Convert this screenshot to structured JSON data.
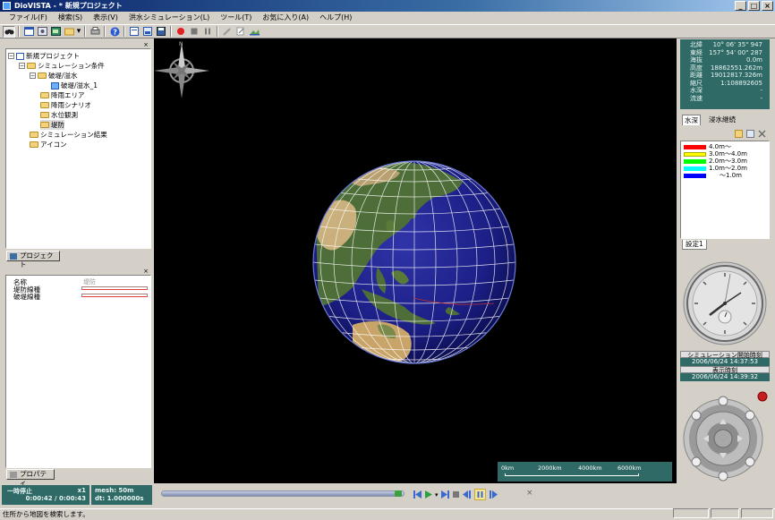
{
  "window": {
    "title": "DioVISTA - * 新規プロジェクト",
    "min": "_",
    "max": "□",
    "close": "×"
  },
  "menu": [
    "ファイル(F)",
    "検索(S)",
    "表示(V)",
    "洪水シミュレーション(L)",
    "ツール(T)",
    "お気に入り(A)",
    "ヘルプ(H)"
  ],
  "project_panel": {
    "close": "×",
    "tree": {
      "root": "新規プロジェクト",
      "sim_cond": "シミュレーション条件",
      "break_overflow": "破堤/溢水",
      "break_overflow_1": "破堤/溢水_1",
      "rain_area": "降雨エリア",
      "rain_scenario": "降雨シナリオ",
      "water_level": "水位観測",
      "levee": "堤防",
      "sim_results": "シミュレーション結果",
      "icons": "アイコン"
    },
    "tab": "プロジェクト"
  },
  "property_panel": {
    "close": "×",
    "header_name": "名称",
    "header_val": "堤防",
    "rows": [
      {
        "name": "堤防線種"
      },
      {
        "name": "破堤線種"
      }
    ],
    "tab": "プロパティ"
  },
  "sim_status": {
    "state": "一時停止",
    "speed": "x1",
    "time": "0:00:42 / 0:00:43",
    "mesh": "mesh: 50m",
    "dt": "dt: 1.000000s"
  },
  "playback": {
    "close": "×"
  },
  "scale_bar": {
    "labels": [
      "0km",
      "2000km",
      "4000km",
      "6000km"
    ]
  },
  "compass": {
    "north": "N"
  },
  "info": {
    "rows": [
      {
        "k": "北緯",
        "v": "10° 06' 35\" 947"
      },
      {
        "k": "東経",
        "v": "157° 54' 00\" 287"
      },
      {
        "k": "海抜",
        "v": "0.0m"
      },
      {
        "k": "高度",
        "v": "18862551.262m"
      },
      {
        "k": "距離",
        "v": "19012817.326m"
      },
      {
        "k": "縮尺",
        "v": "1:108892605"
      },
      {
        "k": "水深",
        "v": "-"
      },
      {
        "k": "流速",
        "v": "-"
      }
    ]
  },
  "depth_tabs": [
    "水深",
    "浸水継続"
  ],
  "legend": {
    "items": [
      {
        "color": "#ff0000",
        "label": "4.0m～"
      },
      {
        "color": "#ffff00",
        "label": "3.0m～4.0m"
      },
      {
        "color": "#00ff00",
        "label": "2.0m～3.0m"
      },
      {
        "color": "#00ffff",
        "label": "1.0m～2.0m"
      },
      {
        "color": "#0000ff",
        "label": "～1.0m"
      }
    ],
    "settings_tab": "設定1"
  },
  "clock": {
    "sim_start_label": "シミュレーション開始時刻",
    "sim_start_value": "2006/06/24 14:37:53",
    "display_label": "表示時刻",
    "display_value": "2006/06/24 14:39:32"
  },
  "statusbar": {
    "text": "住所から地図を検索します。"
  }
}
